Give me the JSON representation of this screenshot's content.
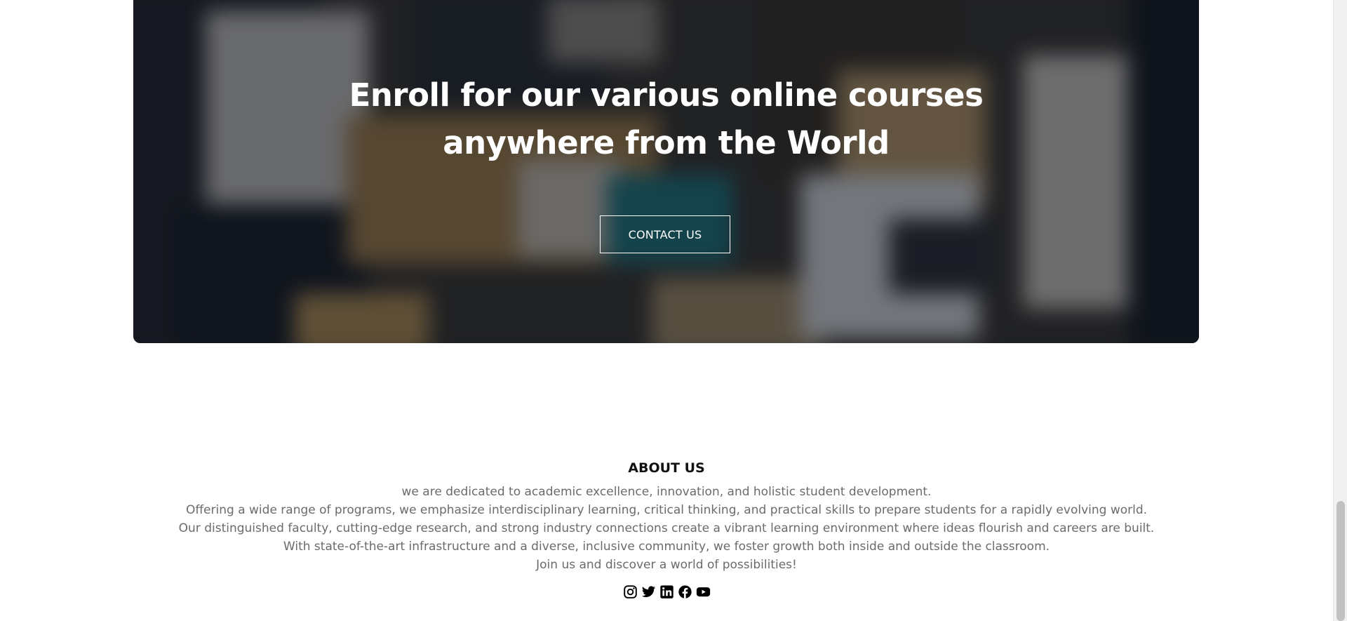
{
  "hero": {
    "title_line1": "Enroll for our various online courses",
    "title_line2": "anywhere from the World",
    "contact_label": "CONTACT US"
  },
  "about": {
    "heading": "ABOUT US",
    "lines": [
      "we are dedicated to academic excellence, innovation, and holistic student development.",
      "Offering a wide range of programs, we emphasize interdisciplinary learning, critical thinking, and practical skills to prepare students for a rapidly evolving world.",
      "Our distinguished faculty, cutting-edge research, and strong industry connections create a vibrant learning environment where ideas flourish and careers are built.",
      "With state-of-the-art infrastructure and a diverse, inclusive community, we foster growth both inside and outside the classroom.",
      "Join us and discover a world of possibilities!"
    ]
  },
  "socials": [
    {
      "icon": "instagram-icon"
    },
    {
      "icon": "twitter-icon"
    },
    {
      "icon": "linkedin-icon"
    },
    {
      "icon": "facebook-icon"
    },
    {
      "icon": "youtube-icon"
    }
  ],
  "colors": {
    "hero_overlay": "#0c121e",
    "heading_text": "#111111",
    "body_text": "#6b6b6b",
    "white": "#ffffff"
  }
}
